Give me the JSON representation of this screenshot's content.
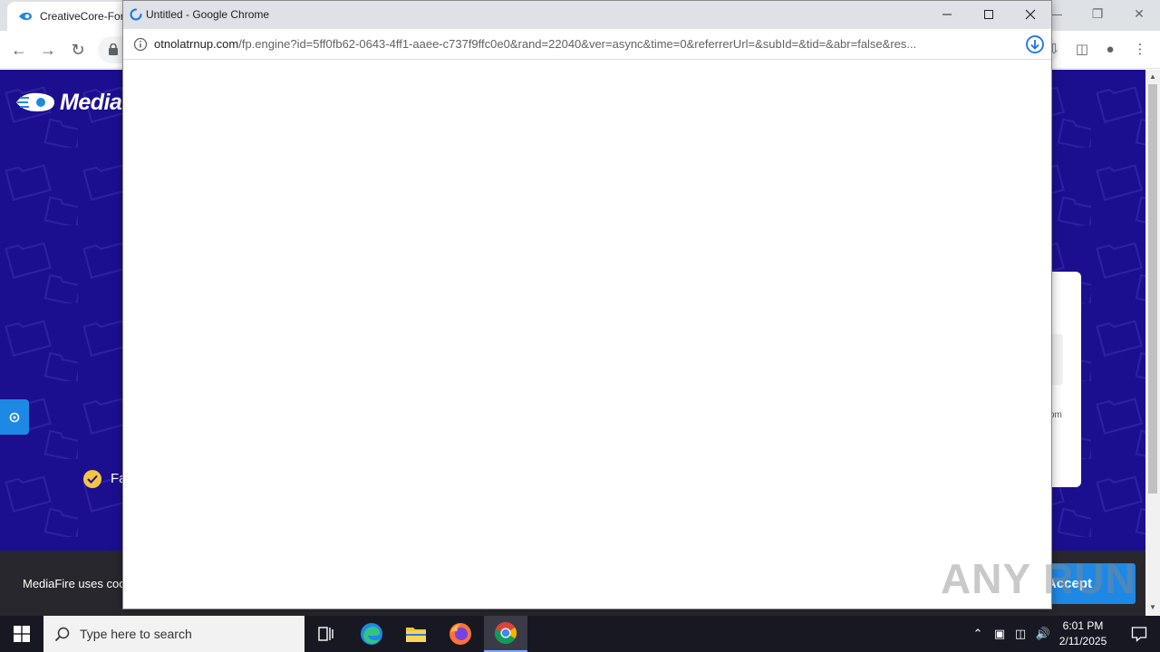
{
  "background_browser": {
    "tab_title": "CreativeCore-For",
    "page": {
      "logo_text": "Media",
      "check_text": "Fa",
      "card_text": "om"
    },
    "cookie_bar": {
      "text": "MediaFire uses coo",
      "accept_label": "Accept"
    }
  },
  "popup": {
    "title": "Untitled - Google Chrome",
    "url_host": "otnolatrnup.com",
    "url_path": "/fp.engine?id=5ff0fb62-0643-4ff1-aaee-c737f9ffc0e0&rand=22040&ver=async&time=0&referrerUrl=&subId=&tid=&abr=false&res..."
  },
  "watermark": {
    "text": "ANY RUN"
  },
  "taskbar": {
    "search_placeholder": "Type here to search",
    "time": "6:01 PM",
    "date": "2/11/2025"
  },
  "colors": {
    "mediafire_bg": "#1c0f8f",
    "accent_blue": "#1e88e5",
    "taskbar": "#181822"
  }
}
